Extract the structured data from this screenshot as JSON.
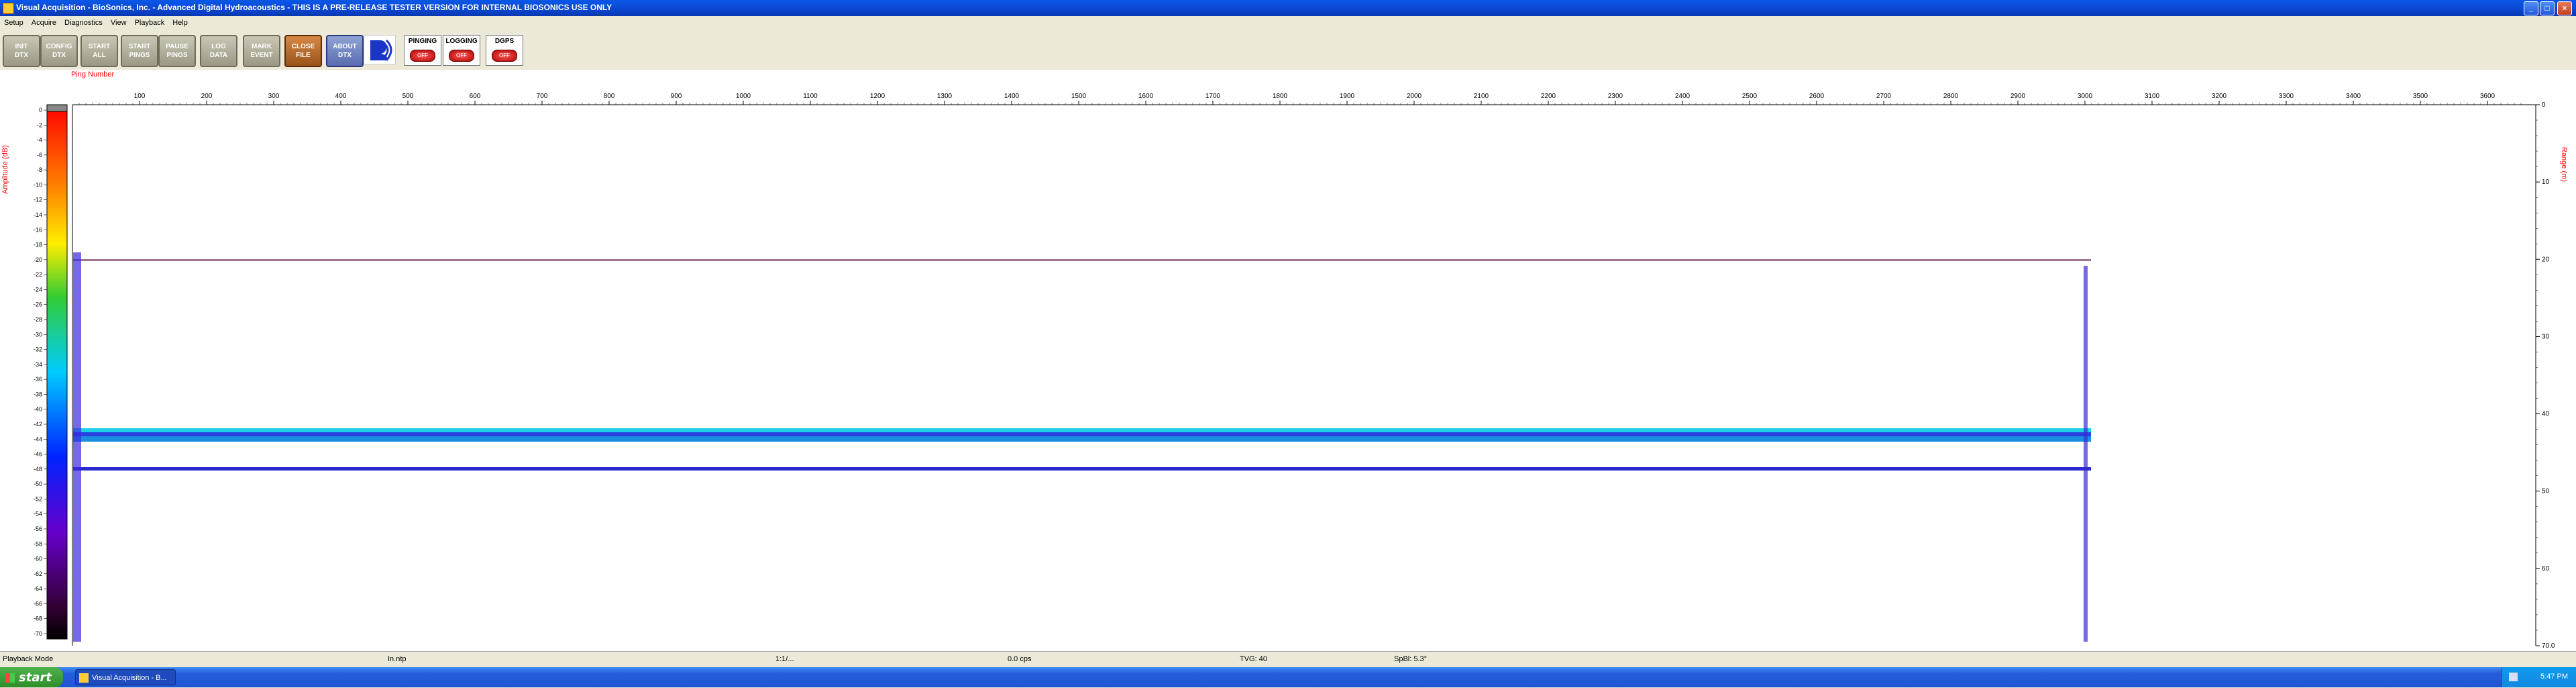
{
  "window": {
    "title": "Visual Acquisition  -  BioSonics, Inc.  -  Advanced Digital Hydroacoustics  -  THIS IS A PRE-RELEASE TESTER VERSION FOR INTERNAL BIOSONICS USE ONLY",
    "minimize": "_",
    "maximize": "□",
    "close": "×"
  },
  "menu": [
    "Setup",
    "Acquire",
    "Diagnostics",
    "View",
    "Playback",
    "Help"
  ],
  "toolbar": {
    "buttons": [
      "INIT\nDTX",
      "CONFIG\nDTX",
      "START\nALL",
      "START\nPINGS",
      "PAUSE\nPINGS",
      "LOG\nDATA",
      "MARK\nEVENT",
      "CLOSE\nFILE",
      "ABOUT\nDTX"
    ],
    "status": [
      {
        "label": "PINGING",
        "state": "OFF"
      },
      {
        "label": "LOGGING",
        "state": "OFF"
      },
      {
        "label": "DGPS",
        "state": "OFF"
      }
    ]
  },
  "echogram": {
    "x_title": "Ping Number",
    "x_ticks": [
      "100",
      "200",
      "300",
      "400",
      "500",
      "600",
      "700",
      "800",
      "900",
      "1000",
      "1100",
      "1200",
      "1300",
      "1400",
      "1500",
      "1600",
      "1700",
      "1800",
      "1900",
      "2000",
      "2100",
      "2200",
      "2300",
      "2400",
      "2500",
      "2600",
      "2700",
      "2800",
      "2900",
      "3000",
      "3100",
      "3200",
      "3300",
      "3400",
      "3500",
      "3600"
    ],
    "left_title": "Amplitude (dB)",
    "left_ticks": [
      "0",
      "-2",
      "-4",
      "-6",
      "-8",
      "-10",
      "-12",
      "-14",
      "-16",
      "-18",
      "-20",
      "-22",
      "-24",
      "-26",
      "-28",
      "-30",
      "-32",
      "-34",
      "-36",
      "-38",
      "-40",
      "-42",
      "-44",
      "-46",
      "-48",
      "-50",
      "-52",
      "-54",
      "-56",
      "-58",
      "-60",
      "-62",
      "-64",
      "-66",
      "-68",
      "-70"
    ],
    "right_title": "Range (m)",
    "right_ticks": [
      "0",
      "10",
      "20",
      "30",
      "40",
      "50",
      "60",
      "70.0"
    ],
    "pings_recorded": 3000,
    "colors": {
      "axis": "#ff0000",
      "bg": "#ffffff"
    }
  },
  "status_bar": [
    "Playback Mode",
    "In.ntp",
    "1:1/...",
    "0.0 cps",
    "TVG: 40",
    "SpBl: 5.3°"
  ],
  "taskbar": {
    "start": "start",
    "task": "Visual Acquisition - B...",
    "clock": "5:47 PM"
  }
}
